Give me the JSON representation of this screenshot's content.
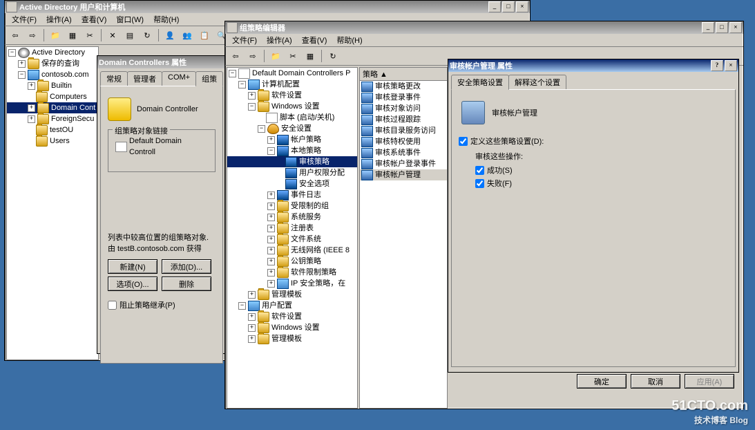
{
  "win1": {
    "title": "Active Directory 用户和计算机",
    "menus": [
      "文件(F)",
      "操作(A)",
      "查看(V)",
      "窗口(W)",
      "帮助(H)"
    ],
    "tree": [
      {
        "l": 0,
        "exp": "-",
        "icon": "gear",
        "t": "Active Directory"
      },
      {
        "l": 1,
        "exp": "+",
        "icon": "fold",
        "t": "保存的查询"
      },
      {
        "l": 1,
        "exp": "-",
        "icon": "comp",
        "t": "contosob.com"
      },
      {
        "l": 2,
        "exp": "+",
        "icon": "fold",
        "t": "Builtin"
      },
      {
        "l": 2,
        "exp": " ",
        "icon": "fold",
        "t": "Computers"
      },
      {
        "l": 2,
        "exp": "+",
        "icon": "fold",
        "t": "Domain Cont",
        "sel": true
      },
      {
        "l": 2,
        "exp": "+",
        "icon": "fold",
        "t": "ForeignSecu"
      },
      {
        "l": 2,
        "exp": " ",
        "icon": "fold",
        "t": "testOU"
      },
      {
        "l": 2,
        "exp": " ",
        "icon": "fold",
        "t": "Users"
      }
    ]
  },
  "dlg1": {
    "title": "Domain Controllers 属性",
    "tabs": [
      "常规",
      "管理者",
      "COM+",
      "组策"
    ],
    "heading": "Domain Controller",
    "group1": "组策略对象链接",
    "linkitem": "Default Domain Controll",
    "note1": "列表中较高位置的组策略对象.",
    "note2": "由 testB.contosob.com 获得",
    "btns": {
      "new": "新建(N)",
      "add": "添加(D)...",
      "opt": "选项(O)...",
      "del": "删除"
    },
    "block": "阻止策略继承(P)"
  },
  "win2": {
    "title": "组策略编辑器",
    "menus": [
      "文件(F)",
      "操作(A)",
      "查看(V)",
      "帮助(H)"
    ],
    "tree": [
      {
        "l": 0,
        "exp": "-",
        "icon": "doc",
        "t": "Default Domain Controllers P"
      },
      {
        "l": 1,
        "exp": "-",
        "icon": "comp",
        "t": "计算机配置"
      },
      {
        "l": 2,
        "exp": "+",
        "icon": "fold",
        "t": "软件设置"
      },
      {
        "l": 2,
        "exp": "-",
        "icon": "fold",
        "t": "Windows 设置"
      },
      {
        "l": 3,
        "exp": " ",
        "icon": "doc",
        "t": "脚本 (启动/关机)"
      },
      {
        "l": 3,
        "exp": "-",
        "icon": "shield",
        "t": "安全设置"
      },
      {
        "l": 4,
        "exp": "+",
        "icon": "book",
        "t": "帐户策略"
      },
      {
        "l": 4,
        "exp": "-",
        "icon": "book",
        "t": "本地策略"
      },
      {
        "l": 5,
        "exp": " ",
        "icon": "book",
        "t": "审核策略",
        "sel": true
      },
      {
        "l": 5,
        "exp": " ",
        "icon": "book",
        "t": "用户权限分配"
      },
      {
        "l": 5,
        "exp": " ",
        "icon": "book",
        "t": "安全选项"
      },
      {
        "l": 4,
        "exp": "+",
        "icon": "book",
        "t": "事件日志"
      },
      {
        "l": 4,
        "exp": "+",
        "icon": "fold",
        "t": "受限制的组"
      },
      {
        "l": 4,
        "exp": "+",
        "icon": "fold",
        "t": "系统服务"
      },
      {
        "l": 4,
        "exp": "+",
        "icon": "fold",
        "t": "注册表"
      },
      {
        "l": 4,
        "exp": "+",
        "icon": "fold",
        "t": "文件系统"
      },
      {
        "l": 4,
        "exp": "+",
        "icon": "fold",
        "t": "无线网络 (IEEE 8"
      },
      {
        "l": 4,
        "exp": "+",
        "icon": "fold",
        "t": "公钥策略"
      },
      {
        "l": 4,
        "exp": "+",
        "icon": "fold",
        "t": "软件限制策略"
      },
      {
        "l": 4,
        "exp": "+",
        "icon": "comp",
        "t": "IP 安全策略，在"
      },
      {
        "l": 2,
        "exp": "+",
        "icon": "fold",
        "t": "管理模板"
      },
      {
        "l": 1,
        "exp": "-",
        "icon": "comp",
        "t": "用户配置"
      },
      {
        "l": 2,
        "exp": "+",
        "icon": "fold",
        "t": "软件设置"
      },
      {
        "l": 2,
        "exp": "+",
        "icon": "fold",
        "t": "Windows 设置"
      },
      {
        "l": 2,
        "exp": "+",
        "icon": "fold",
        "t": "管理模板"
      }
    ],
    "listheader": "策略 ▲",
    "list": [
      "审核策略更改",
      "审核登录事件",
      "审核对象访问",
      "审核过程跟踪",
      "审核目录服务访问",
      "审核特权使用",
      "审核系统事件",
      "审核帐户登录事件",
      "审核帐户管理"
    ],
    "selected": "审核帐户管理"
  },
  "dlg2": {
    "title": "审核帐户管理 属性",
    "tabs": [
      "安全策略设置",
      "解释这个设置"
    ],
    "heading": "审核帐户管理",
    "define": "定义这些策略设置(D):",
    "subhead": "审核这些操作:",
    "success": "成功(S)",
    "failure": "失败(F)",
    "ok": "确定",
    "cancel": "取消",
    "apply": "应用(A)"
  },
  "watermark": {
    "main": "51CTO.com",
    "sub": "技术博客   Blog"
  }
}
